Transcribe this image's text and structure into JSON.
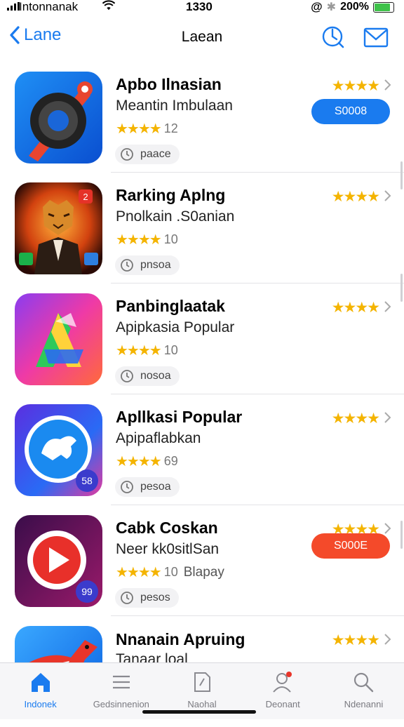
{
  "status_bar": {
    "carrier": "Intonnanak",
    "time": "1330",
    "battery": "200%",
    "battery_color": "#3ec24a"
  },
  "nav": {
    "back_label": "Lane",
    "title": "Laean",
    "icons": [
      "search-icon",
      "mail-icon"
    ],
    "accent": "#1a7bef"
  },
  "apps": [
    {
      "name": "Apbo Ilnasian",
      "subtitle": "Meantin Imbulaan",
      "rating_stars": "★★★★",
      "rating_count": "12",
      "extra": "",
      "chip": "paace",
      "right_stars": "★★★★",
      "button": "S0008",
      "button_color": "#1a7bef",
      "icon": "camera-lens-icon",
      "badge": ""
    },
    {
      "name": "Rarking Aplng",
      "subtitle": "Pnolkain .S0anian",
      "rating_stars": "★★★★",
      "rating_count": "10",
      "extra": "",
      "chip": "pnsoa",
      "right_stars": "★★★★",
      "button": "",
      "icon": "tiger-game-icon",
      "badge": "2"
    },
    {
      "name": "Panbinglaatak",
      "subtitle": "Apipkasia Popular",
      "rating_stars": "★★★★",
      "rating_count": "10",
      "extra": "",
      "chip": "nosoa",
      "right_stars": "★★★★",
      "button": "",
      "icon": "gradient-a-icon",
      "badge": ""
    },
    {
      "name": "Apllkasi Popular",
      "subtitle": "Apipaflabkan",
      "rating_stars": "★★★★",
      "rating_count": "69",
      "extra": "",
      "chip": "pesoa",
      "right_stars": "★★★★",
      "button": "",
      "icon": "lion-circle-icon",
      "badge": "58"
    },
    {
      "name": "Cabk Coskan",
      "subtitle": "Neer kk0sitlSan",
      "rating_stars": "★★★★",
      "rating_count": "10",
      "extra": "Blapay",
      "chip": "pesos",
      "right_stars": "★★★★",
      "button": "S000E",
      "button_color": "#f44a2a",
      "icon": "play-button-icon",
      "badge": "99"
    },
    {
      "name": "Nnanain Apruing",
      "subtitle": "Tanaar loal",
      "rating_stars": "",
      "rating_count": "",
      "extra": "",
      "chip": "",
      "right_stars": "★★★★",
      "button": "",
      "icon": "bird-icon",
      "badge": ""
    }
  ],
  "tabs": [
    {
      "label": "Indonek",
      "icon": "home-icon",
      "active": true
    },
    {
      "label": "Gedsinnenion",
      "icon": "list-icon",
      "active": false
    },
    {
      "label": "Naohal",
      "icon": "document-icon",
      "active": false
    },
    {
      "label": "Deonant",
      "icon": "person-icon",
      "active": false
    },
    {
      "label": "Ndenanni",
      "icon": "search-icon",
      "active": false
    }
  ]
}
